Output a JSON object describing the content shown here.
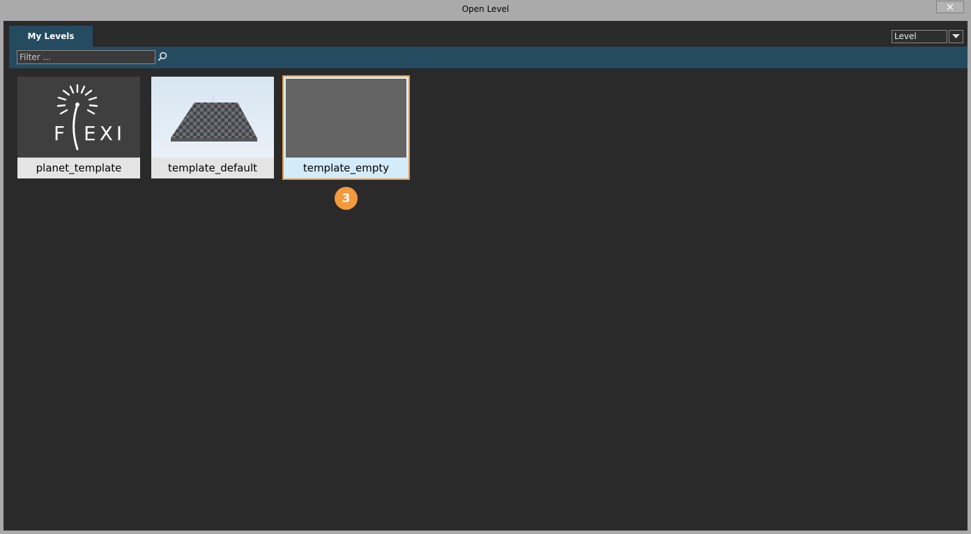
{
  "window": {
    "title": "Open Level"
  },
  "tabs": [
    {
      "label": "My Levels"
    }
  ],
  "sort": {
    "selected": "Level"
  },
  "filter": {
    "placeholder": "Filter ..."
  },
  "levels": [
    {
      "name": "planet_template",
      "thumbnail": "flexi-logo",
      "logo_text": "FLEXI"
    },
    {
      "name": "template_default",
      "thumbnail": "checker-plane"
    },
    {
      "name": "template_empty",
      "thumbnail": "empty-gray",
      "selected": true
    }
  ],
  "step_badge": "3",
  "colors": {
    "accent": "#f29a3b",
    "tab_bar": "#254b60",
    "background": "#2a2a2a",
    "selected_label_bg": "#d4ebfa"
  },
  "icons": {
    "close": "close-icon",
    "search": "search-icon",
    "dropdown": "chevron-down-icon"
  }
}
